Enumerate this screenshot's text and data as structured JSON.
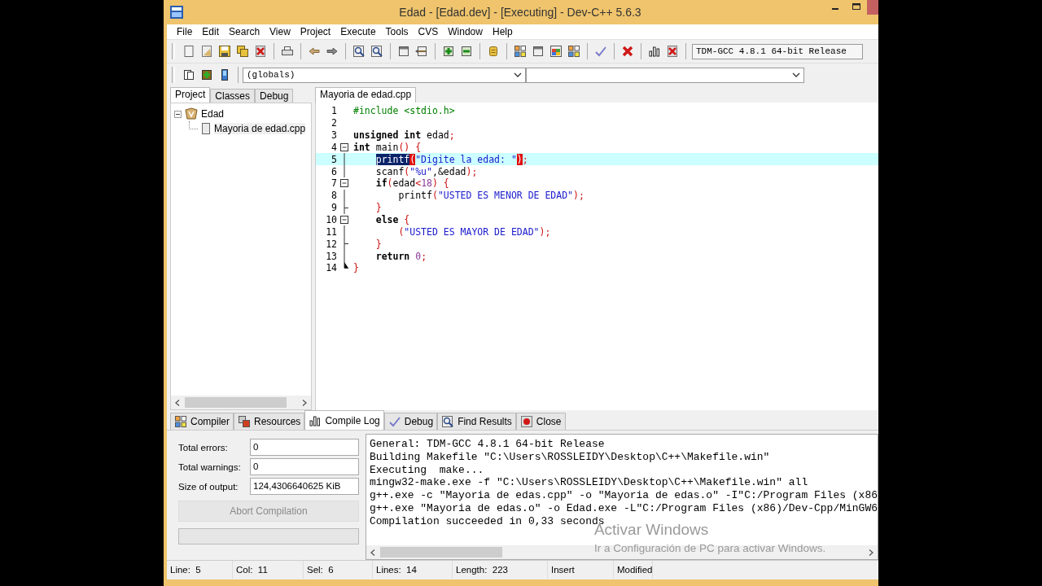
{
  "window": {
    "title": "Edad - [Edad.dev] - [Executing] - Dev-C++ 5.6.3"
  },
  "menu": [
    "File",
    "Edit",
    "Search",
    "View",
    "Project",
    "Execute",
    "Tools",
    "CVS",
    "Window",
    "Help"
  ],
  "compiler_select": {
    "value": "TDM-GCC 4.8.1 64-bit Release"
  },
  "scope_select": {
    "value": "(globals)"
  },
  "left_tabs": [
    {
      "label": "Project",
      "selected": true
    },
    {
      "label": "Classes",
      "selected": false
    },
    {
      "label": "Debug",
      "selected": false
    }
  ],
  "project_tree": [
    {
      "label": "Edad",
      "expanded": true,
      "children": [
        {
          "label": "Mayoria de edad.cpp"
        }
      ]
    }
  ],
  "editor_tabs": [
    {
      "label": "Mayoria de edad.cpp",
      "selected": true
    }
  ],
  "code": [
    {
      "n": "1",
      "kind": "plain",
      "current": false,
      "tokens": [
        {
          "text": "#include <stdio.h>",
          "kind": "pre"
        }
      ]
    },
    {
      "n": "2",
      "kind": "plain",
      "current": false
    },
    {
      "n": "3",
      "kind": "plain",
      "current": false,
      "tokens": [
        {
          "text": "unsigned int",
          "kind": "kw"
        },
        {
          "text": " edad",
          "kind": "plain"
        },
        {
          "text": ";",
          "kind": "sym"
        }
      ]
    },
    {
      "n": "4",
      "kind": "fold-start",
      "current": false,
      "tokens": [
        {
          "text": "int",
          "kind": "kw"
        },
        {
          "text": " main",
          "kind": "plain"
        },
        {
          "text": "() {",
          "kind": "sym"
        }
      ]
    },
    {
      "n": "5",
      "kind": "in-fold",
      "current": true,
      "tokens": [
        {
          "text": "    printf",
          "kind": "sel"
        },
        {
          "text": "(",
          "kind": "match"
        },
        {
          "text": "\"Digite la edad: \"",
          "kind": "str"
        },
        {
          "text": ")",
          "kind": "match"
        },
        {
          "text": ";",
          "kind": "sym"
        }
      ]
    },
    {
      "n": "6",
      "kind": "in-fold",
      "current": false,
      "tokens": [
        {
          "text": "    scanf",
          "kind": "plain"
        },
        {
          "text": "(",
          "kind": "sym"
        },
        {
          "text": "\"%u\"",
          "kind": "str"
        },
        {
          "text": ",&edad",
          "kind": "plain"
        },
        {
          "text": ");",
          "kind": "sym"
        }
      ]
    },
    {
      "n": "7",
      "kind": "fold-start",
      "current": false,
      "tokens": [
        {
          "text": "    if",
          "kind": "kw"
        },
        {
          "text": "(",
          "kind": "sym"
        },
        {
          "text": "edad",
          "kind": "plain"
        },
        {
          "text": "<",
          "kind": "sym"
        },
        {
          "text": "18",
          "kind": "num"
        },
        {
          "text": ") {",
          "kind": "sym"
        }
      ]
    },
    {
      "n": "8",
      "kind": "in-fold",
      "current": false,
      "tokens": [
        {
          "text": "        printf",
          "kind": "plain"
        },
        {
          "text": "(",
          "kind": "sym"
        },
        {
          "text": "\"USTED ES MENOR DE EDAD\"",
          "kind": "str"
        },
        {
          "text": ");",
          "kind": "sym"
        }
      ]
    },
    {
      "n": "9",
      "kind": "fold-end",
      "current": false,
      "tokens": [
        {
          "text": "    }",
          "kind": "sym"
        }
      ]
    },
    {
      "n": "10",
      "kind": "fold-start",
      "current": false,
      "tokens": [
        {
          "text": "    else",
          "kind": "kw"
        },
        {
          "text": " {",
          "kind": "sym"
        }
      ]
    },
    {
      "n": "11",
      "kind": "in-fold",
      "current": false,
      "tokens": [
        {
          "text": "        (",
          "kind": "sym"
        },
        {
          "text": "\"USTED ES MAYOR DE EDAD\"",
          "kind": "str"
        },
        {
          "text": ");",
          "kind": "sym"
        }
      ]
    },
    {
      "n": "12",
      "kind": "fold-end",
      "current": false,
      "tokens": [
        {
          "text": "    }",
          "kind": "sym"
        }
      ]
    },
    {
      "n": "13",
      "kind": "in-fold",
      "current": false,
      "tokens": [
        {
          "text": "    return",
          "kind": "kw"
        },
        {
          "text": " 0",
          "kind": "num"
        },
        {
          "text": ";",
          "kind": "sym"
        }
      ]
    },
    {
      "n": "14",
      "kind": "fold-last",
      "current": false,
      "tokens": [
        {
          "text": "}",
          "kind": "sym"
        }
      ]
    }
  ],
  "bottom_tabs": [
    {
      "label": "Compiler",
      "selected": false
    },
    {
      "label": "Resources",
      "selected": false
    },
    {
      "label": "Compile Log",
      "selected": true
    },
    {
      "label": "Debug",
      "selected": false
    },
    {
      "label": "Find Results",
      "selected": false
    },
    {
      "label": "Close",
      "selected": false
    }
  ],
  "stats": [
    {
      "label": "Total errors:",
      "value": "0"
    },
    {
      "label": "Total warnings:",
      "value": "0"
    },
    {
      "label": "Size of output:",
      "value": "124,4306640625 KiB"
    }
  ],
  "abort_button": {
    "label": "Abort Compilation",
    "disabled": true
  },
  "progress": {
    "level": 0
  },
  "log": [
    "General: TDM-GCC 4.8.1 64-bit Release",
    "Building Makefile \"C:\\Users\\ROSSLEIDY\\Desktop\\C++\\Makefile.win\"",
    "Executing  make...",
    "mingw32-make.exe -f \"C:\\Users\\ROSSLEIDY\\Desktop\\C++\\Makefile.win\" all",
    "g++.exe -c \"Mayoria de edas.cpp\" -o \"Mayoria de edas.o\" -I\"C:/Program Files (x86",
    "g++.exe \"Mayoria de edas.o\" -o Edad.exe -L\"C:/Program Files (x86)/Dev-Cpp/MinGW6",
    "Compilation succeeded in 0,33 seconds"
  ],
  "activation_notice": {
    "title": "Activar Windows",
    "text": "Ir a Configuración de PC para activar Windows."
  },
  "status_bar": [
    {
      "label": "Line:",
      "value": "5"
    },
    {
      "label": "Col:",
      "value": "11"
    },
    {
      "label": "Sel:",
      "value": "6"
    },
    {
      "label": "Lines:",
      "value": "14"
    },
    {
      "label": "Length:",
      "value": "223"
    },
    {
      "value": "Insert"
    },
    {
      "value": "Modified"
    }
  ]
}
